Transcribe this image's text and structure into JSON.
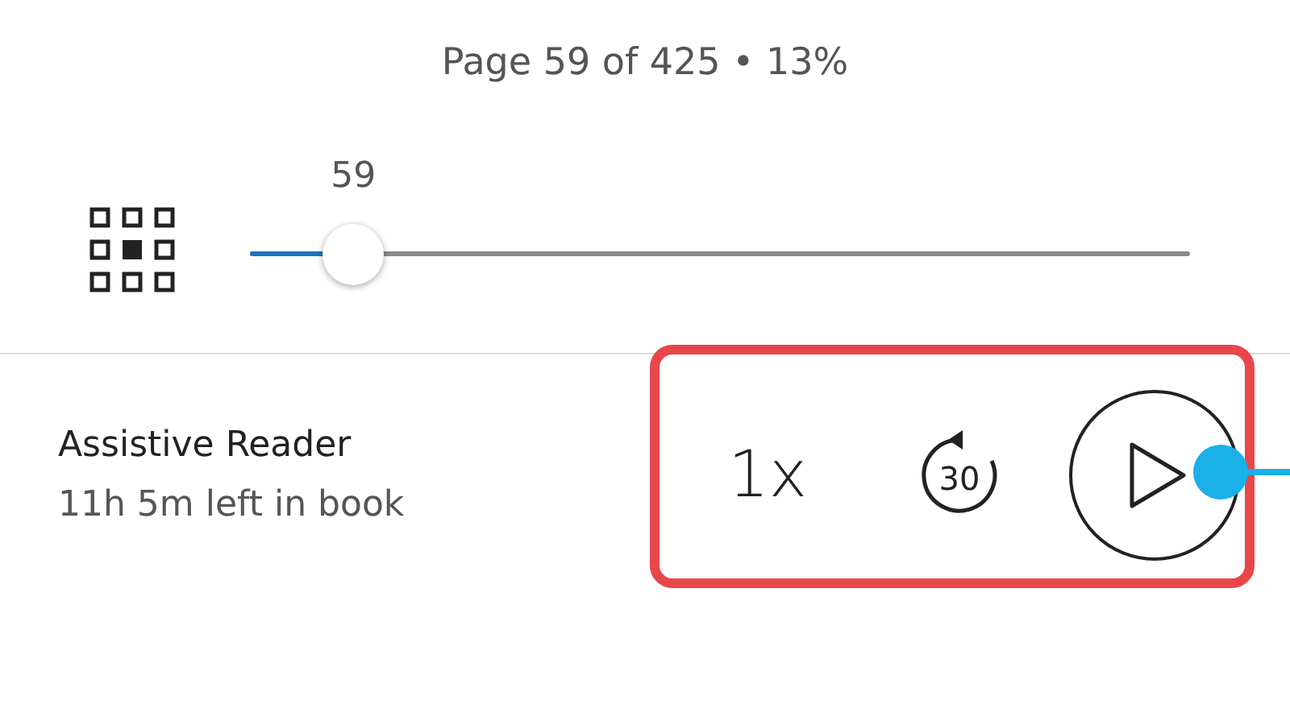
{
  "page_status": "Page 59 of 425 • 13%",
  "slider": {
    "value_label": "59",
    "level": 0.11
  },
  "reader": {
    "title": "Assistive Reader",
    "time_left": "11h 5m left in book"
  },
  "controls": {
    "speed": "1x",
    "skip_back": "30"
  }
}
